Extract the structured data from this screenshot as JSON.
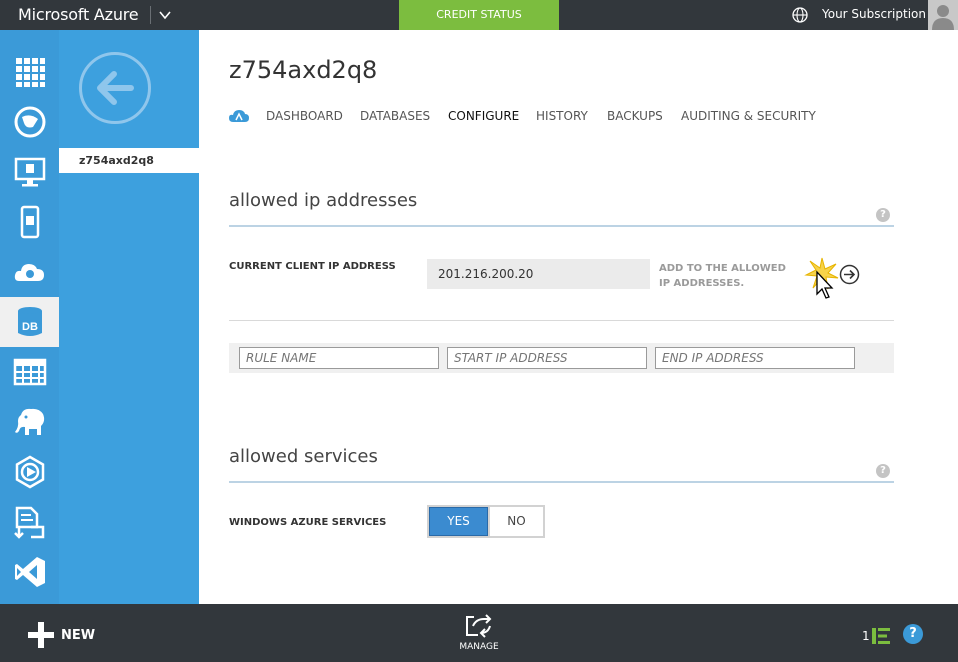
{
  "topbar": {
    "brand": "Microsoft Azure",
    "credit_status": "CREDIT STATUS",
    "subscription": "Your Subscription"
  },
  "rail": {
    "items": [
      "all-items",
      "web-sites",
      "virtual-machines",
      "mobile-services",
      "cloud-services",
      "sql-databases",
      "storage",
      "hdinsight",
      "media-services",
      "service-bus",
      "visual-studio-online"
    ],
    "db_label": "DB"
  },
  "subnav": {
    "item": "z754axd2q8"
  },
  "main": {
    "title": "z754axd2q8",
    "tabs": [
      "DASHBOARD",
      "DATABASES",
      "CONFIGURE",
      "HISTORY",
      "BACKUPS",
      "AUDITING & SECURITY"
    ],
    "active_tab": "CONFIGURE",
    "allowed_ip": {
      "heading": "allowed ip addresses",
      "current_label": "CURRENT CLIENT IP ADDRESS",
      "current_value": "201.216.200.20",
      "add_text": "ADD TO THE ALLOWED IP ADDRESSES.",
      "rule_name_placeholder": "RULE NAME",
      "start_ip_placeholder": "START IP ADDRESS",
      "end_ip_placeholder": "END IP ADDRESS"
    },
    "allowed_services": {
      "heading": "allowed services",
      "label": "WINDOWS AZURE SERVICES",
      "yes": "YES",
      "no": "NO",
      "selected": "YES"
    },
    "help": "?"
  },
  "bottombar": {
    "new_label": "NEW",
    "manage_label": "MANAGE",
    "notification_count": "1",
    "help": "?"
  },
  "colors": {
    "topbar": "#32373c",
    "accent_green": "#7cbd3f",
    "rail_blue": "#3b9ad8",
    "toggle_blue": "#3b8bd0"
  }
}
